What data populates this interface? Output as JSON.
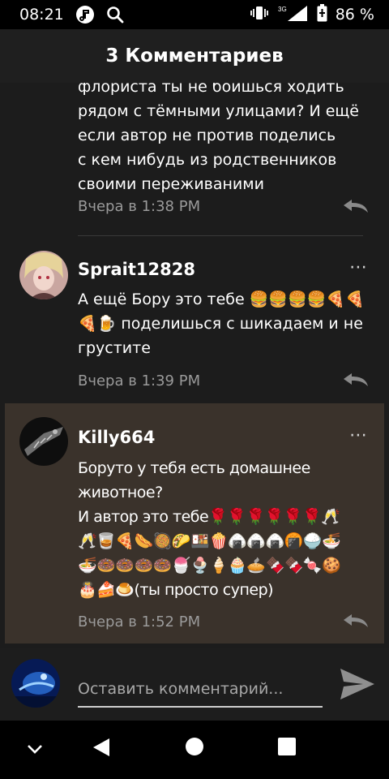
{
  "status": {
    "time": "08:21",
    "battery": "86 %",
    "network": "3G"
  },
  "header": {
    "title": "3 Комментариев"
  },
  "comments": [
    {
      "username": "",
      "text": "флориста ты не боишься ходить\nрядом с тёмными улицами? И ещё\nесли автор не против поделись\nс кем нибудь из родственников\nсвоими переживаними",
      "time": "Вчера в 1:38 PM"
    },
    {
      "username": "Sprait12828",
      "text": "А ещё Бору это тебе 🍔🍔🍔🍔🍕🍕\n🍕🍺 поделишься с шикадаем и не\nгрустите",
      "time": "Вчера в 1:39 PM"
    },
    {
      "username": "Killy664",
      "text": "Боруто у тебя есть домашнее\nживотное?\nИ автор это тебе🌹🌹🌹🌹🌹🌹🥂\n🥂🥃🍕🌭🥘🌮🍱🍿🍙🍙🍙🍘🍚🍜\n🍜🍩🍩🍩🍩🍧🍨🍦🧁🥧🍫🍫🍬🍪\n🎂🍰🍮(ты просто супер)",
      "time": "Вчера в 1:52 PM"
    }
  ],
  "composer": {
    "placeholder": "Оставить комментарий..."
  },
  "icons": {
    "more": "⋯",
    "reply": "reply-arrow",
    "send": "send-arrow"
  },
  "colors": {
    "highlight": "#3a322b",
    "background": "#1c1c1c",
    "header": "#1f1f1f"
  }
}
